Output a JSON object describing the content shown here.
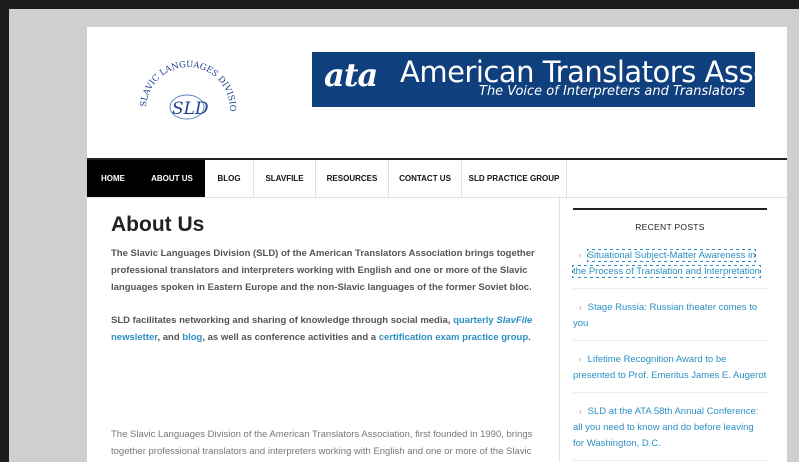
{
  "header": {
    "sld_logo_text": "SLAVIC LANGUAGES DIVISION",
    "sld_logo_mark": "SLD",
    "ata_mark": "ata",
    "ata_name": "American Translators Association",
    "ata_tagline": "The Voice of Interpreters and Translators"
  },
  "nav": {
    "items": [
      {
        "label": "HOME"
      },
      {
        "label": "ABOUT US"
      },
      {
        "label": "BLOG"
      },
      {
        "label": "SLAVFILE"
      },
      {
        "label": "RESOURCES"
      },
      {
        "label": "CONTACT US"
      },
      {
        "label": "SLD PRACTICE GROUP"
      }
    ]
  },
  "main": {
    "title": "About Us",
    "intro_p1": "The Slavic Languages Division (SLD) of the American Translators Association brings together professional translators and interpreters working with English and one or more of the Slavic languages spoken in Eastern Europe and the non-Slavic languages of the former Soviet bloc.",
    "intro_p2": {
      "t1": "SLD facilitates networking and sharing of knowledge through social media, ",
      "l1": "quarterly ",
      "l1b": "SlavFile",
      "l1c": " newsletter",
      "t2": ", and ",
      "l2": "blog",
      "t3": ", as well as conference activities and a ",
      "l3": "certification exam practice group",
      "t4": "."
    },
    "body_p": "The Slavic Languages Division of the American Translators Association, first founded in 1990, brings together professional translators and interpreters working with English and one or more of the Slavic languages spoken in Eastern Europe and the non-Slavic languages of the former"
  },
  "sidebar": {
    "title": "RECENT POSTS",
    "posts": [
      {
        "text": "Situational Subject-Matter Awareness in the Process of Translation and Interpretation"
      },
      {
        "text": "Stage Russia: Russian theater comes to you"
      },
      {
        "text": "Lifetime Recognition Award to be presented to Prof. Emeritus James E. Augerot"
      },
      {
        "text": "SLD at the ATA 58th Annual Conference: all you need to know and do before leaving for Washington, D.C."
      }
    ]
  },
  "colors": {
    "ata_blue": "#0f3f7c",
    "link": "#2b8fc4",
    "nav_active_bg": "#000000"
  }
}
